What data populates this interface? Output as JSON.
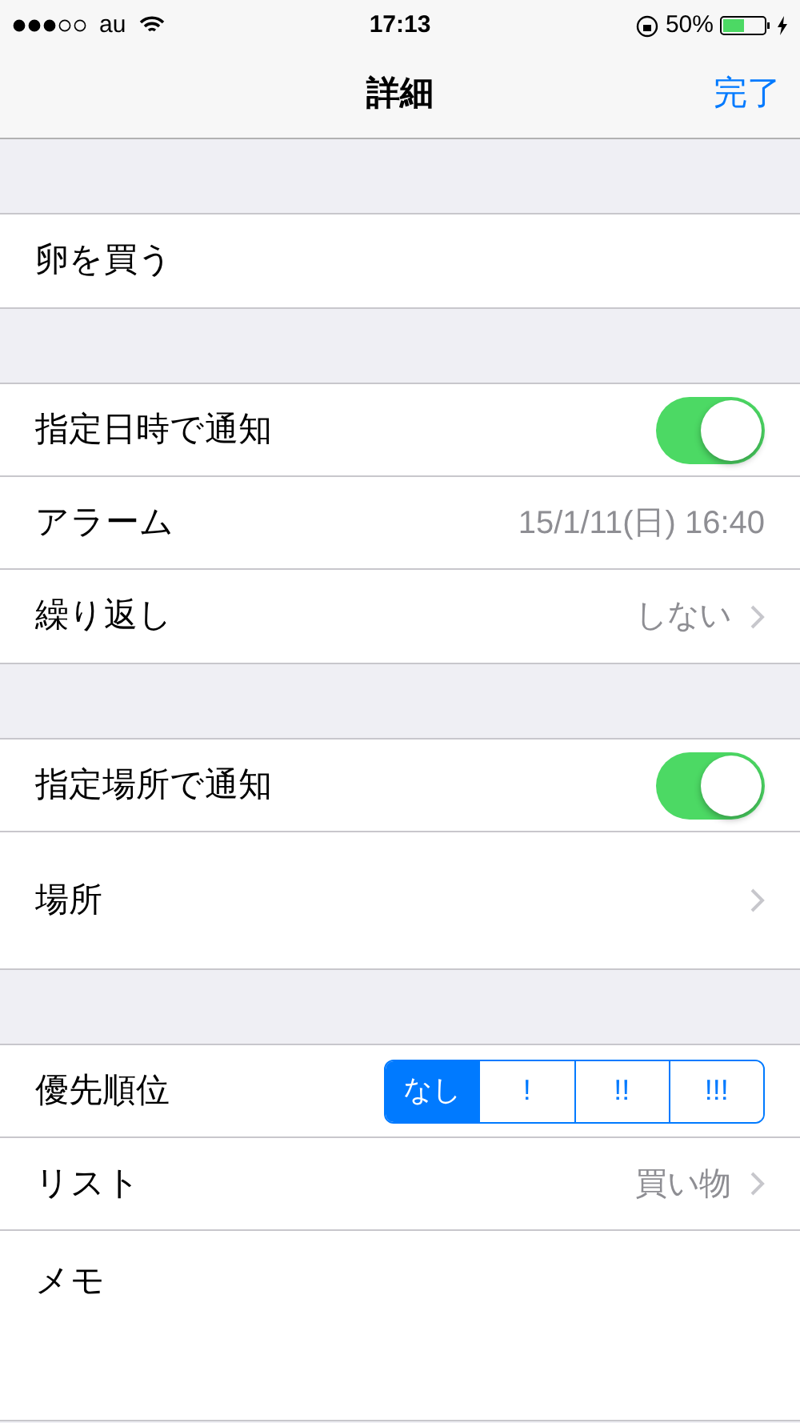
{
  "status_bar": {
    "carrier": "au",
    "time": "17:13",
    "battery": "50%"
  },
  "nav": {
    "title": "詳細",
    "done": "完了"
  },
  "sections": [
    {
      "rows": [
        {
          "kind": "text",
          "label": "卵を買う"
        }
      ]
    },
    {
      "rows": [
        {
          "kind": "toggle",
          "label": "指定日時で通知",
          "on": true
        },
        {
          "kind": "value",
          "label": "アラーム",
          "value": "15/1/11(日) 16:40"
        },
        {
          "kind": "disclosure",
          "label": "繰り返し",
          "value": "しない"
        }
      ]
    },
    {
      "rows": [
        {
          "kind": "toggle",
          "label": "指定場所で通知",
          "on": true
        },
        {
          "kind": "disclosure",
          "label": "場所",
          "tall": true
        }
      ]
    },
    {
      "rows": [
        {
          "kind": "segmented",
          "label": "優先順位",
          "options": [
            {
              "label": "なし",
              "selected": true
            },
            {
              "label": "!",
              "selected": false
            },
            {
              "label": "!!",
              "selected": false
            },
            {
              "label": "!!!",
              "selected": false
            }
          ]
        },
        {
          "kind": "disclosure",
          "label": "リスト",
          "value": "買い物"
        },
        {
          "kind": "memo",
          "label": "メモ"
        }
      ]
    }
  ]
}
